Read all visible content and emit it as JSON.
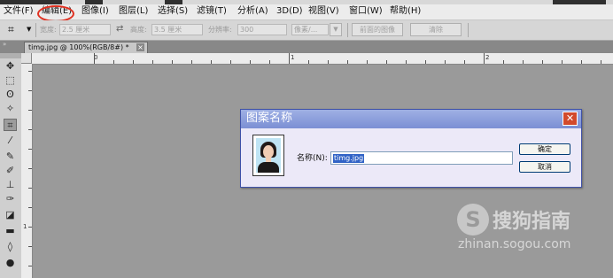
{
  "menubar": {
    "items": [
      "文件(F)",
      "编辑(E)",
      "图像(I)",
      "图层(L)",
      "选择(S)",
      "滤镜(T)",
      "分析(A)",
      "3D(D)",
      "视图(V)",
      "窗口(W)",
      "帮助(H)"
    ]
  },
  "options": {
    "width_label": "宽度:",
    "width_value": "2.5 厘米",
    "height_label": "高度:",
    "height_value": "3.5 厘米",
    "resolution_label": "分辨率:",
    "resolution_value": "300",
    "unit_value": "像素/...",
    "front_image_button": "前面的图像",
    "clear_button": "清除"
  },
  "document": {
    "tab_title": "timg.jpg @ 100%(RGB/8#) *"
  },
  "rulers": {
    "h_labels": [
      "0",
      "1",
      "2"
    ],
    "v_labels": [
      "1"
    ]
  },
  "dialog": {
    "title": "图案名称",
    "name_label": "名称(N):",
    "name_value": "timg.jpg",
    "ok_button": "确定",
    "cancel_button": "取消"
  },
  "watermark": {
    "brand": "搜狗指南",
    "url": "zhinan.sogou.com"
  },
  "colors": {
    "highlight_oval": "#e03020",
    "dialog_title": "#7b8fd4",
    "selection": "#3163c6"
  }
}
